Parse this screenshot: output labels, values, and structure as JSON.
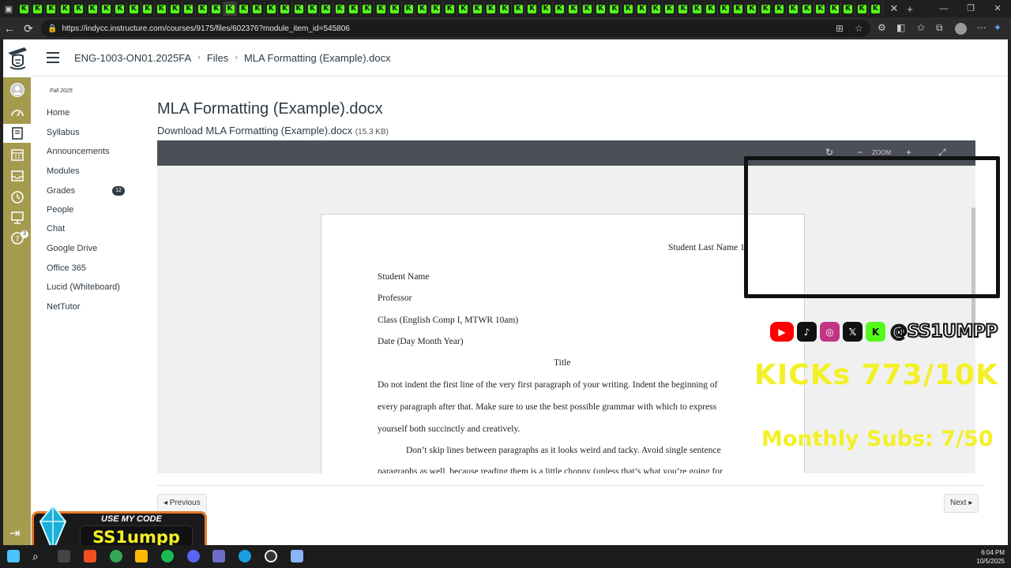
{
  "browser": {
    "tab_icon_letter": "K",
    "tab_count": 63,
    "url": "https://indycc.instructure.com/courses/9175/files/602376?module_item_id=545806"
  },
  "header": {
    "breadcrumb": [
      "ENG-1003-ON01.2025FA",
      "Files",
      "MLA Formatting (Example).docx"
    ]
  },
  "course_nav": {
    "term": "Fall 2025",
    "items": [
      {
        "label": "Home"
      },
      {
        "label": "Syllabus"
      },
      {
        "label": "Announcements"
      },
      {
        "label": "Modules"
      },
      {
        "label": "Grades",
        "badge": "12"
      },
      {
        "label": "People"
      },
      {
        "label": "Chat"
      },
      {
        "label": "Google Drive"
      },
      {
        "label": "Office 365"
      },
      {
        "label": "Lucid (Whiteboard)"
      },
      {
        "label": "NetTutor"
      }
    ]
  },
  "global_nav": {
    "help_badge": "3"
  },
  "file": {
    "title": "MLA Formatting (Example).docx",
    "download_label": "Download MLA Formatting (Example).docx",
    "size": "(15.3 KB)"
  },
  "viewer": {
    "zoom_label": "ZOOM",
    "doc": {
      "header": "Student Last Name 1",
      "lines": [
        "Student Name",
        "Professor",
        "Class (English Comp I, MTWR 10am)",
        "Date (Day Month Year)"
      ],
      "title": "Title",
      "para1": [
        "Do not indent the first line of the very first paragraph of your writing. Indent the beginning of",
        "every paragraph after that. Make sure to use the best possible grammar with which to express",
        "yourself both succinctly and creatively."
      ],
      "para2": [
        "Don’t skip lines between paragraphs as it looks weird and tacky. Avoid single sentence",
        "paragraphs as well, because reading them is a little choppy (unless that’s what you’re going for"
      ]
    }
  },
  "pager": {
    "previous": "◂ Previous",
    "next": "Next ▸"
  },
  "overlay": {
    "handle": "@SS1UMPP",
    "kicks": "KICKs 773/10K",
    "subs": "Monthly Subs: 7/50",
    "promo_top": "USE MY CODE",
    "promo_code": "SS1umpp",
    "accent_yellow": "#f3f027"
  },
  "taskbar": {
    "time": "6:04 PM",
    "date": "10/5/2025"
  }
}
